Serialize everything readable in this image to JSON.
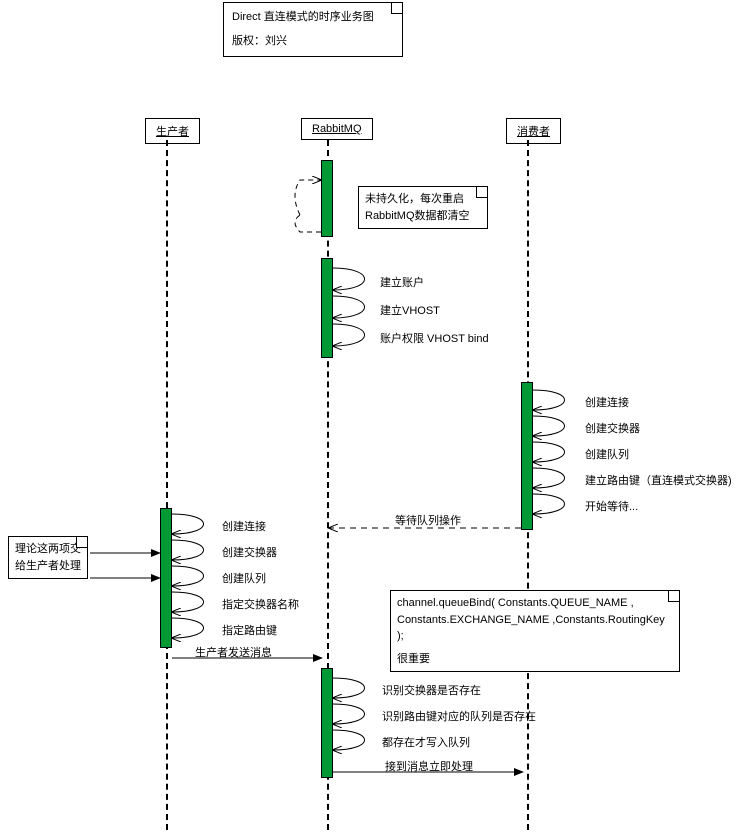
{
  "diagram": {
    "title_line1": "Direct 直连模式的时序业务图",
    "title_line2": "版权：刘兴",
    "actors": {
      "producer": "生产者",
      "rabbitmq": "RabbitMQ",
      "consumer": "消费者"
    },
    "notes": {
      "persist": "未持久化，每次重启RabbitMQ数据都清空",
      "delegate": "理论这两项交给生产者处理",
      "bind_code1": "channel.queueBind( Constants.QUEUE_NAME ,",
      "bind_code2": "Constants.EXCHANGE_NAME ,Constants.RoutingKey  );",
      "bind_code3": "很重要"
    },
    "rabbit_self": {
      "s1": "建立账户",
      "s2": "建立VHOST",
      "s3": "账户权限 VHOST bind"
    },
    "consumer_self": {
      "c1": "创建连接",
      "c2": "创建交换器",
      "c3": "创建队列",
      "c4": "建立路由键（直连模式交换器)",
      "c5": "开始等待..."
    },
    "producer_self": {
      "p1": "创建连接",
      "p2": "创建交换器",
      "p3": "创建队列",
      "p4": "指定交换器名称",
      "p5": "指定路由键"
    },
    "rabbit_process": {
      "r1": "识别交换器是否存在",
      "r2": "识别路由键对应的队列是否存在",
      "r3": "都存在才写入队列"
    },
    "messages": {
      "wait_queue": "等待队列操作",
      "send": "生产者发送消息",
      "recv": "接到消息立即处理"
    }
  }
}
